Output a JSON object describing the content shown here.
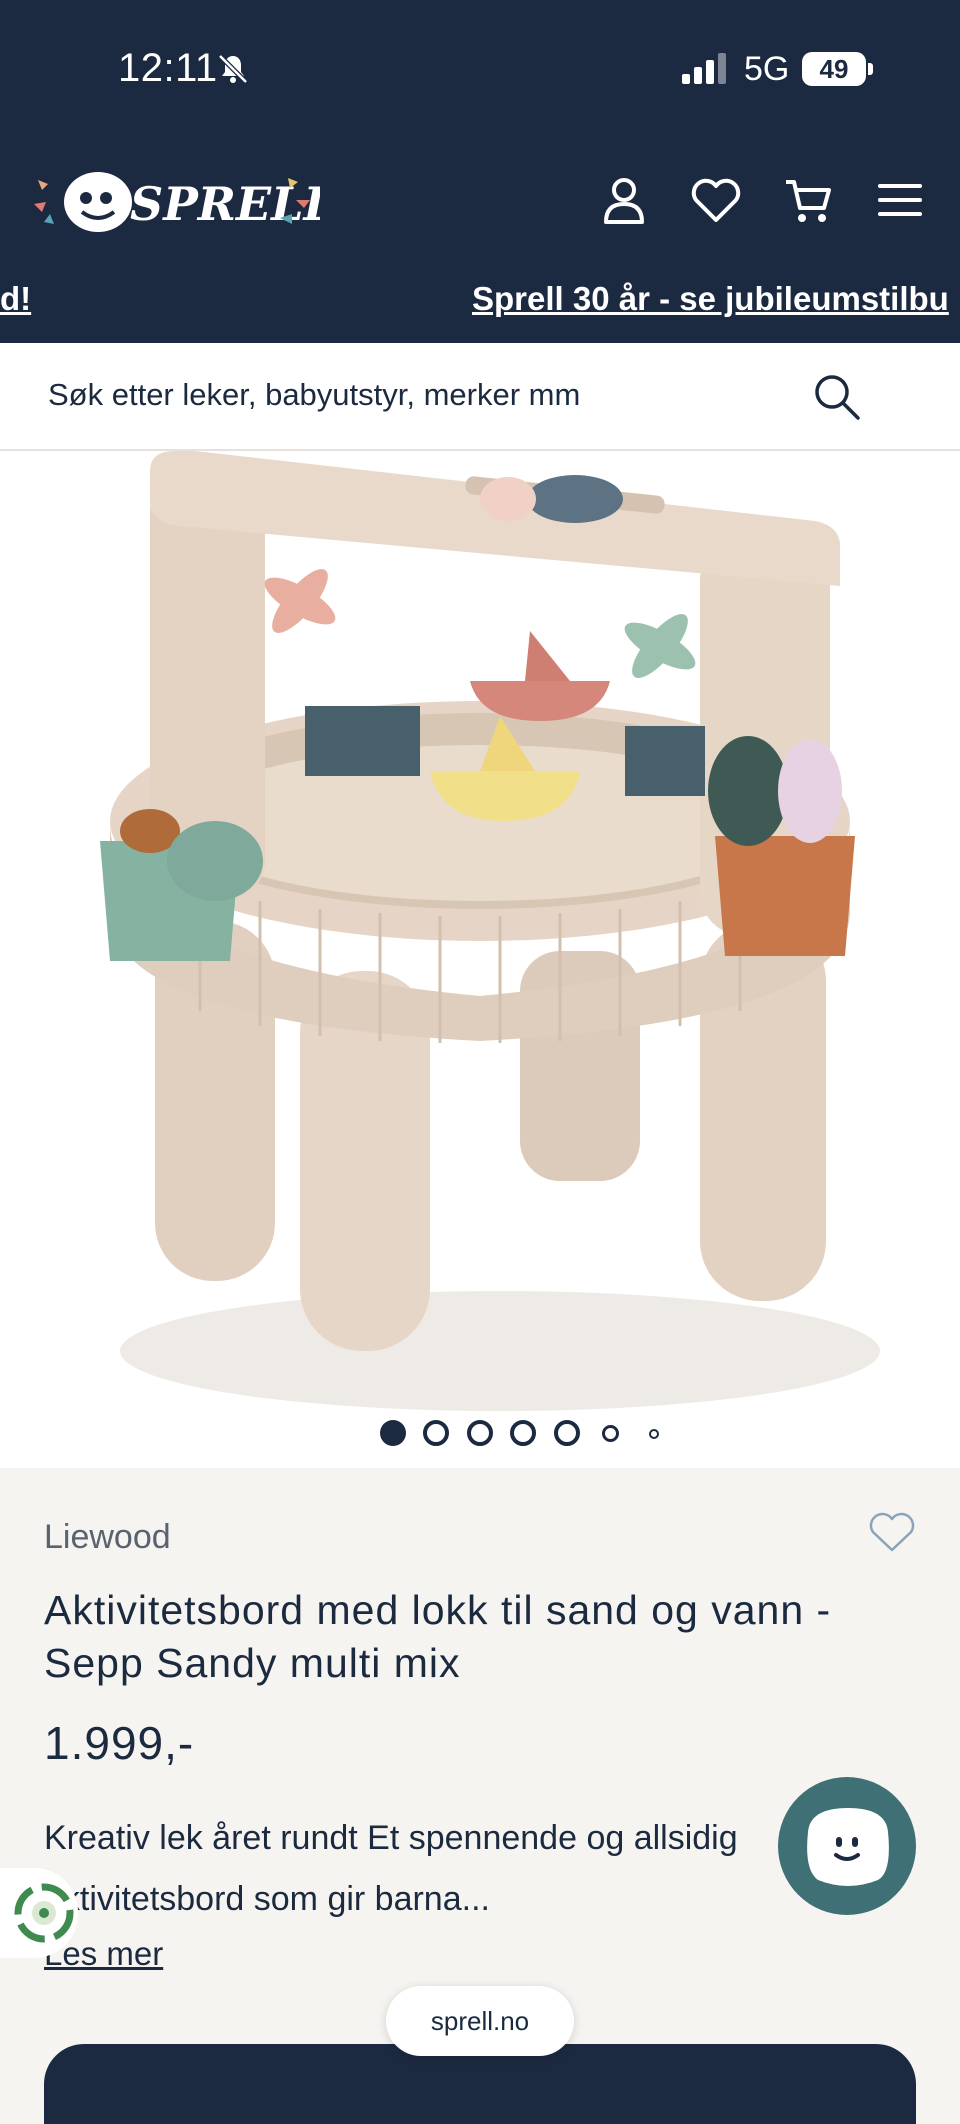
{
  "status_bar": {
    "time": "12:11",
    "network": "5G",
    "battery": "49"
  },
  "header": {
    "logo_text": "SPRELL",
    "ticker_left": "d!",
    "ticker_right": "Sprell 30 år - se jubileumstilbu"
  },
  "search": {
    "placeholder": "Søk etter leker, babyutstyr, merker mm"
  },
  "gallery": {
    "image_count": 7,
    "active_index": 0
  },
  "product": {
    "brand": "Liewood",
    "title": "Aktivitetsbord med lokk til sand og vann - Sepp Sandy multi mix",
    "price": "1.999,-",
    "description": "Kreativ lek året rundt Et spennende og allsidig aktivitetsbord som gir barna...",
    "read_more": "Les mer"
  },
  "browser": {
    "url": "sprell.no"
  },
  "colors": {
    "navy": "#1c2a41",
    "teal": "#3e7076",
    "background": "#f6f4f1"
  }
}
